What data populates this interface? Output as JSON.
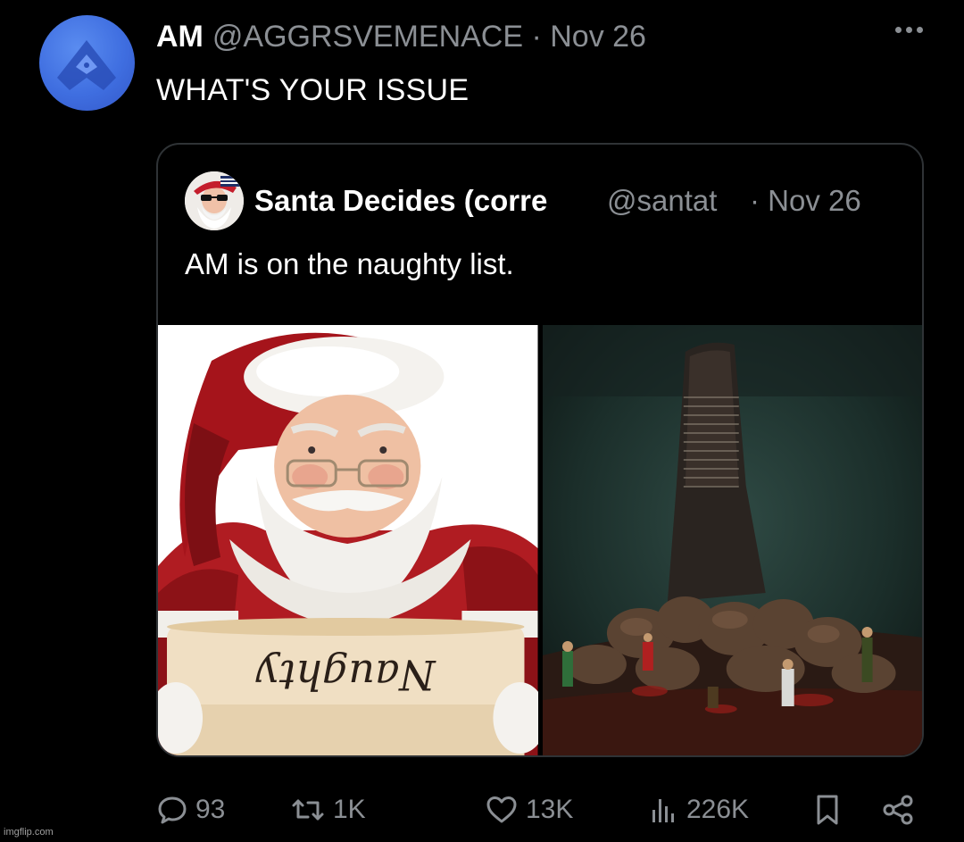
{
  "tweet": {
    "author_name": "AM",
    "handle_date": "@AGGRSVEMENACE · Nov 26",
    "text": "WHAT'S YOUR ISSUE"
  },
  "quoted": {
    "author_name": "Santa Decides (corre",
    "handle": "@santat",
    "date": "· Nov 26",
    "text": "AM is on the naughty list.",
    "scroll_text": "Naughty"
  },
  "actions": {
    "replies": "93",
    "retweets": "1K",
    "likes": "13K",
    "views": "226K"
  },
  "watermark": "imgflip.com",
  "colors": {
    "background": "#000000",
    "text_primary": "#ffffff",
    "text_secondary": "#8b8f94",
    "border": "#2f3336",
    "avatar_blue": "#3f6ee0"
  }
}
